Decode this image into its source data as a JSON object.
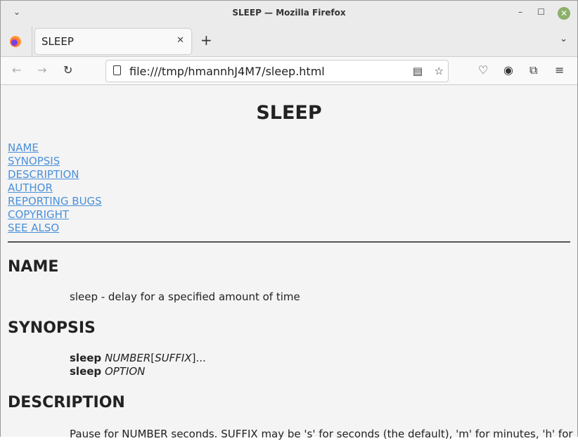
{
  "window": {
    "title": "SLEEP — Mozilla Firefox"
  },
  "tab": {
    "label": "SLEEP"
  },
  "url": "file:///tmp/hmannhJ4M7/sleep.html",
  "page": {
    "title": "SLEEP",
    "toc": [
      "NAME",
      "SYNOPSIS",
      "DESCRIPTION",
      "AUTHOR",
      "REPORTING BUGS",
      "COPYRIGHT",
      "SEE ALSO"
    ],
    "name_heading": "NAME",
    "name_text": "sleep - delay for a specified amount of time",
    "synopsis_heading": "SYNOPSIS",
    "syn1_cmd": "sleep",
    "syn1_a": "NUMBER",
    "syn1_b": "[",
    "syn1_c": "SUFFIX",
    "syn1_d": "]...",
    "syn2_cmd": "sleep",
    "syn2_a": "OPTION",
    "description_heading": "DESCRIPTION",
    "description_text": "Pause for NUMBER seconds. SUFFIX may be 's' for seconds (the default), 'm' for minutes, 'h' for"
  }
}
